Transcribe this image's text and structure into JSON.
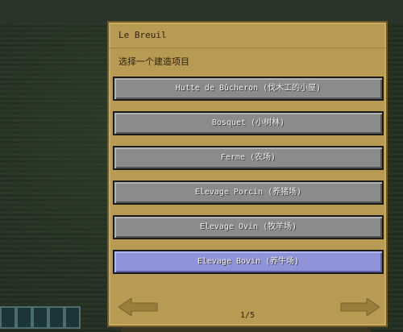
{
  "dialog": {
    "title": "Le Breuil",
    "subtitle": "选择一个建造项目",
    "options": [
      {
        "label": "Hutte de Bûcheron (伐木工的小屋)",
        "selected": false
      },
      {
        "label": "Bosquet (小树林)",
        "selected": false
      },
      {
        "label": "Ferme (农场)",
        "selected": false
      },
      {
        "label": "Elevage Porcin (养猪场)",
        "selected": false
      },
      {
        "label": "Elevage Ovin (牧羊场)",
        "selected": false
      },
      {
        "label": "Elevage Bovin (养牛场)",
        "selected": true
      }
    ],
    "page_indicator": "1/5",
    "prev_icon": "arrow-left-icon",
    "next_icon": "arrow-right-icon"
  },
  "colors": {
    "panel": "#b89a52",
    "button": "#8b8b8b",
    "button_selected": "#8f93d9",
    "arrow": "#9b7e3c"
  }
}
